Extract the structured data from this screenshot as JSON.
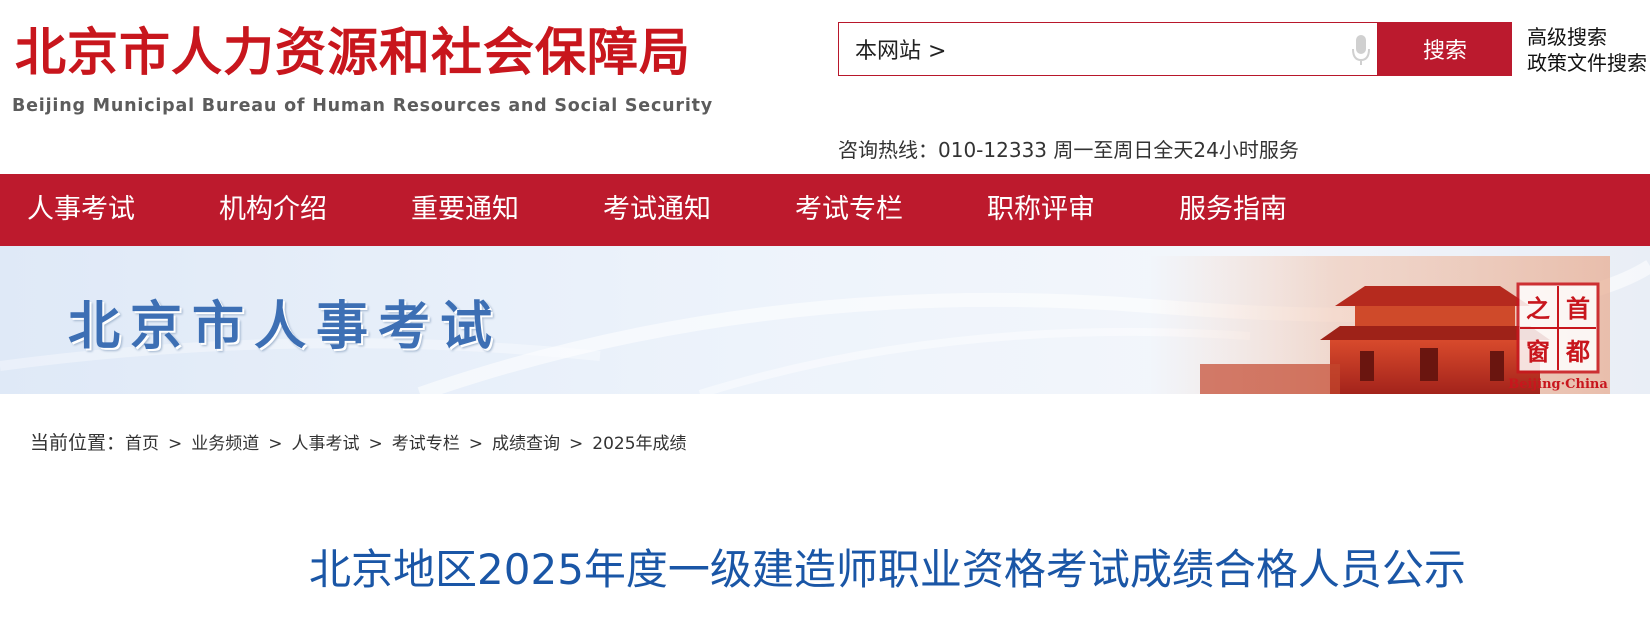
{
  "header": {
    "logo_cn": "北京市人力资源和社会保障局",
    "logo_en": "Beijing Municipal Bureau of Human Resources and Social Security"
  },
  "search": {
    "scope": "本网站 >",
    "button": "搜索",
    "advanced": "高级搜索",
    "policy": "政策文件搜索"
  },
  "hotline": "咨询热线：010-12333 周一至周日全天24小时服务",
  "nav": {
    "items": [
      {
        "label": "人事考试"
      },
      {
        "label": "机构介绍"
      },
      {
        "label": "重要通知"
      },
      {
        "label": "考试通知"
      },
      {
        "label": "考试专栏"
      },
      {
        "label": "职称评审"
      },
      {
        "label": "服务指南"
      }
    ]
  },
  "banner": {
    "title": "北京市人事考试",
    "seal_chars": [
      "首",
      "都",
      "之",
      "窗"
    ],
    "seal_en": "Beijing·China"
  },
  "breadcrumb": {
    "label": "当前位置：",
    "items": [
      "首页",
      "业务频道",
      "人事考试",
      "考试专栏",
      "成绩查询",
      "2025年成绩"
    ]
  },
  "article": {
    "title": "北京地区2025年度一级建造师职业资格考试成绩合格人员公示"
  },
  "colors": {
    "brand_red": "#bd1a2d",
    "title_blue": "#1a56a6",
    "banner_blue": "#3d6fb4"
  }
}
